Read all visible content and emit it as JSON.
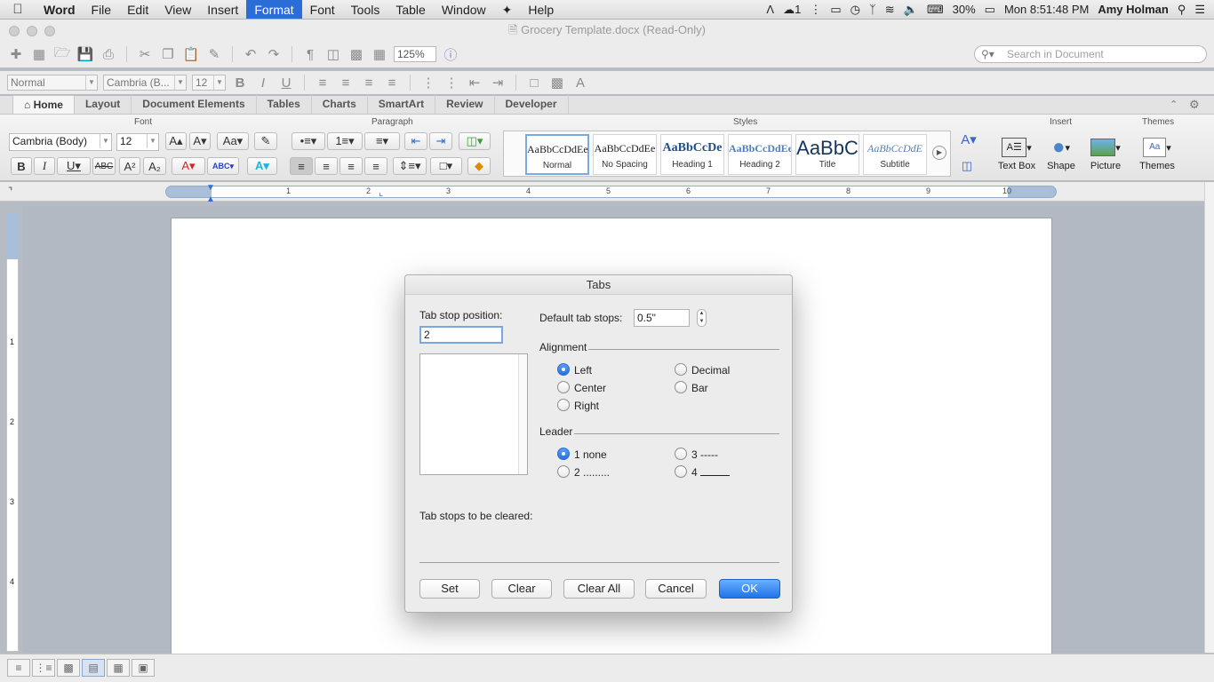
{
  "menubar": {
    "app": "Word",
    "items": [
      "File",
      "Edit",
      "View",
      "Insert",
      "Format",
      "Font",
      "Tools",
      "Table",
      "Window",
      "Help"
    ],
    "active": "Format",
    "battery": "30%",
    "clock": "Mon 8:51:48 PM",
    "user": "Amy Holman",
    "badge": "1"
  },
  "window": {
    "title": "Grocery Template.docx (Read-Only)"
  },
  "toolbar": {
    "zoom": "125%",
    "search_placeholder": "Search in Document",
    "style_value": "Normal",
    "font_value": "Cambria (B...",
    "size_value": "12"
  },
  "ribbon": {
    "tabs": [
      "Home",
      "Layout",
      "Document Elements",
      "Tables",
      "Charts",
      "SmartArt",
      "Review",
      "Developer"
    ],
    "active_tab": "Home",
    "group_font": "Font",
    "group_paragraph": "Paragraph",
    "group_styles": "Styles",
    "group_insert": "Insert",
    "group_themes": "Themes",
    "font_name": "Cambria (Body)",
    "font_size": "12",
    "styles": [
      {
        "preview": "AaBbCcDdEe",
        "label": "Normal"
      },
      {
        "preview": "AaBbCcDdEe",
        "label": "No Spacing"
      },
      {
        "preview": "AaBbCcDe",
        "label": "Heading 1"
      },
      {
        "preview": "AaBbCcDdEe",
        "label": "Heading 2"
      },
      {
        "preview": "AaBbC",
        "label": "Title"
      },
      {
        "preview": "AaBbCcDdE",
        "label": "Subtitle"
      }
    ],
    "insert_items": [
      "Text Box",
      "Shape",
      "Picture"
    ],
    "themes_label": "Themes"
  },
  "ruler": {
    "numbers": [
      "1",
      "2",
      "3",
      "4",
      "5",
      "6",
      "7",
      "8",
      "9",
      "10"
    ],
    "vnumbers": [
      "1",
      "2",
      "3",
      "4"
    ]
  },
  "dialog": {
    "title": "Tabs",
    "tab_stop_label": "Tab stop position:",
    "tab_stop_value": "2",
    "default_tab_label": "Default tab stops:",
    "default_tab_value": "0.5\"",
    "alignment_label": "Alignment",
    "alignment_options": [
      "Left",
      "Center",
      "Right",
      "Decimal",
      "Bar"
    ],
    "alignment_selected": "Left",
    "leader_label": "Leader",
    "leader_options": [
      "1 none",
      "2 .........",
      "3 -----",
      "4 "
    ],
    "leader_selected": "1 none",
    "cleared_label": "Tab stops to be cleared:",
    "buttons": {
      "set": "Set",
      "clear": "Clear",
      "clear_all": "Clear All",
      "cancel": "Cancel",
      "ok": "OK"
    }
  },
  "colors": {
    "accent": "#2a6cd8",
    "ok_button": "#1f73e8"
  }
}
